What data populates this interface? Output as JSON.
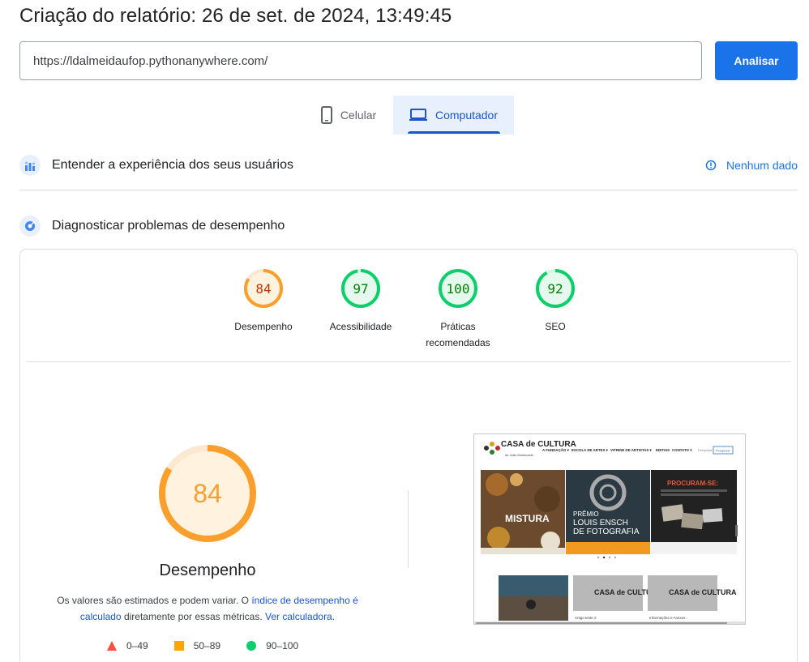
{
  "header": {
    "title": "Criação do relatório: 26 de set. de 2024, 13:49:45"
  },
  "url_input": {
    "value": "https://ldalmeidaufop.pythonanywhere.com/"
  },
  "analyze_button": {
    "label": "Analisar"
  },
  "tabs": [
    {
      "label": "Celular",
      "icon": "phone-icon",
      "selected": false
    },
    {
      "label": "Computador",
      "icon": "laptop-icon",
      "selected": true
    }
  ],
  "sections": {
    "field_data": {
      "label": "Entender a experiência dos seus usuários",
      "status": "Nenhum dado"
    },
    "lab_data": {
      "label": "Diagnosticar problemas de desempenho"
    }
  },
  "scores": [
    {
      "label": "Desempenho",
      "value": "84",
      "color": "#fa9f2b",
      "text_color": "#c33300",
      "fill": "#fff3e0"
    },
    {
      "label": "Acessibilidade",
      "value": "97",
      "color": "#0cce6b",
      "text_color": "#008000",
      "fill": "#e6f9ee"
    },
    {
      "label_line1": "Práticas",
      "label_line2": "recomendadas",
      "value": "100",
      "color": "#0cce6b",
      "text_color": "#008000",
      "fill": "#e6f9ee"
    },
    {
      "label": "SEO",
      "value": "92",
      "color": "#0cce6b",
      "text_color": "#008000",
      "fill": "#e6f9ee"
    }
  ],
  "performance": {
    "score": "84",
    "label": "Desempenho",
    "desc_1": "Os valores são estimados e podem variar. O ",
    "link_1": "índice de desempenho é calculado",
    "desc_2": " diretamente por essas métricas. ",
    "link_2": "Ver calculadora",
    "desc_3": "."
  },
  "legend": [
    {
      "range": "0–49",
      "shape": "triangle",
      "color": "#ff4e42"
    },
    {
      "range": "50–89",
      "shape": "square",
      "color": "#ffa400"
    },
    {
      "range": "90–100",
      "shape": "circle",
      "color": "#0cce6b"
    }
  ],
  "site_preview": {
    "logo": "CASA de CULTURA",
    "logo_sub": "de João Monlevade",
    "nav": [
      "A FUNDAÇÃO ▾",
      "ESCOLA DE ARTES ▾",
      "VITRINE DE ARTISTAS ▾",
      "EDITAIS",
      "CONTATO ▾"
    ],
    "search_placeholder": "Pesquisar",
    "search_button": "Pesquisar",
    "slide_1": "MISTURA",
    "slide_2_line1": "PRÊMIO",
    "slide_2_line2": "LOUIS ENSCH",
    "slide_2_line3": "DE FOTOGRAFIA",
    "slide_3": "PROCURAM-SE:",
    "card_2": "Artigo teste 2",
    "card_3": "Informações e Anexos -"
  }
}
